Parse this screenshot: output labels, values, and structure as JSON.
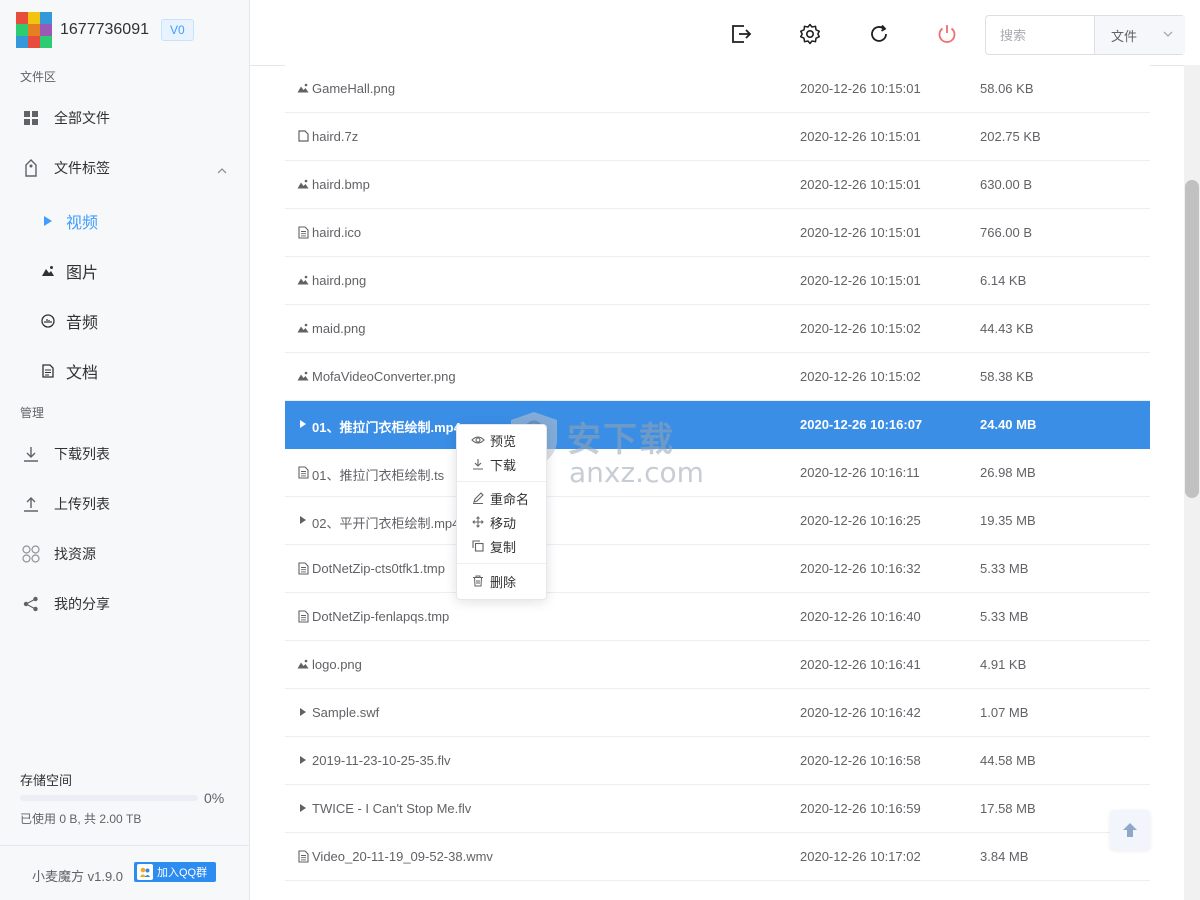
{
  "brand": {
    "user_id": "1677736091",
    "badge": "V0"
  },
  "sidebar": {
    "files_section": "文件区",
    "all_files": "全部文件",
    "file_tags": "文件标签",
    "tags": [
      {
        "label": "视频",
        "icon": "play-icon",
        "active": true
      },
      {
        "label": "图片",
        "icon": "image-icon",
        "active": false
      },
      {
        "label": "音频",
        "icon": "audio-icon",
        "active": false
      },
      {
        "label": "文档",
        "icon": "document-icon",
        "active": false
      }
    ],
    "manage_section": "管理",
    "manage_items": [
      {
        "label": "下载列表",
        "icon": "download-icon"
      },
      {
        "label": "上传列表",
        "icon": "upload-icon"
      },
      {
        "label": "找资源",
        "icon": "find-resource-icon"
      },
      {
        "label": "我的分享",
        "icon": "share-icon"
      }
    ],
    "storage": {
      "title": "存储空间",
      "percent_label": "0%",
      "percent_value": 0,
      "used_text": "已使用 0 B, 共 2.00 TB"
    },
    "version": "小麦魔方 v1.9.0",
    "qq_group": "加入QQ群"
  },
  "header": {
    "search_placeholder": "搜索",
    "search_type": "文件",
    "icons": [
      "logout-icon",
      "settings-icon",
      "refresh-icon",
      "power-icon"
    ],
    "accent": "#409eff",
    "power_color": "#f56c6c"
  },
  "files": [
    {
      "name": "GameHall.png",
      "date": "2020-12-26 10:15:01",
      "size": "58.06 KB",
      "icon": "image-icon"
    },
    {
      "name": "haird.7z",
      "date": "2020-12-26 10:15:01",
      "size": "202.75 KB",
      "icon": "archive-icon"
    },
    {
      "name": "haird.bmp",
      "date": "2020-12-26 10:15:01",
      "size": "630.00 B",
      "icon": "image-icon"
    },
    {
      "name": "haird.ico",
      "date": "2020-12-26 10:15:01",
      "size": "766.00 B",
      "icon": "document-icon"
    },
    {
      "name": "haird.png",
      "date": "2020-12-26 10:15:01",
      "size": "6.14 KB",
      "icon": "image-icon"
    },
    {
      "name": "maid.png",
      "date": "2020-12-26 10:15:02",
      "size": "44.43 KB",
      "icon": "image-icon"
    },
    {
      "name": "MofaVideoConverter.png",
      "date": "2020-12-26 10:15:02",
      "size": "58.38 KB",
      "icon": "image-icon"
    },
    {
      "name": "01、推拉门衣柜绘制.mp4",
      "date": "2020-12-26 10:16:07",
      "size": "24.40 MB",
      "icon": "play-icon",
      "selected": true
    },
    {
      "name": "01、推拉门衣柜绘制.ts",
      "date": "2020-12-26 10:16:11",
      "size": "26.98 MB",
      "icon": "document-icon"
    },
    {
      "name": "02、平开门衣柜绘制.mp4",
      "date": "2020-12-26 10:16:25",
      "size": "19.35 MB",
      "icon": "play-icon"
    },
    {
      "name": "DotNetZip-cts0tfk1.tmp",
      "date": "2020-12-26 10:16:32",
      "size": "5.33 MB",
      "icon": "document-icon"
    },
    {
      "name": "DotNetZip-fenlapqs.tmp",
      "date": "2020-12-26 10:16:40",
      "size": "5.33 MB",
      "icon": "document-icon"
    },
    {
      "name": "logo.png",
      "date": "2020-12-26 10:16:41",
      "size": "4.91 KB",
      "icon": "image-icon"
    },
    {
      "name": "Sample.swf",
      "date": "2020-12-26 10:16:42",
      "size": "1.07 MB",
      "icon": "play-icon"
    },
    {
      "name": "2019-11-23-10-25-35.flv",
      "date": "2020-12-26 10:16:58",
      "size": "44.58 MB",
      "icon": "play-icon"
    },
    {
      "name": "TWICE - I Can't Stop Me.flv",
      "date": "2020-12-26 10:16:59",
      "size": "17.58 MB",
      "icon": "play-icon"
    },
    {
      "name": "Video_20-11-19_09-52-38.wmv",
      "date": "2020-12-26 10:17:02",
      "size": "3.84 MB",
      "icon": "document-icon"
    }
  ],
  "context_menu": {
    "preview": "预览",
    "download": "下载",
    "rename": "重命名",
    "move": "移动",
    "copy": "复制",
    "delete": "删除"
  },
  "watermark": {
    "text": "安下载",
    "sub": "anxz.com"
  }
}
